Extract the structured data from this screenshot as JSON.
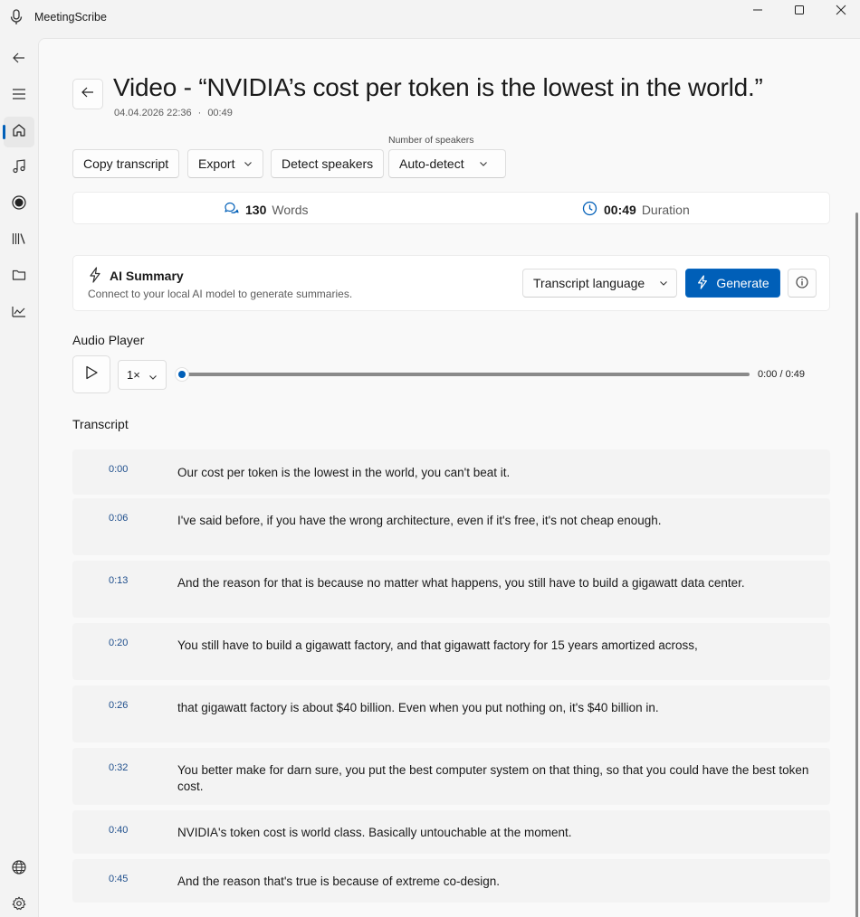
{
  "window": {
    "app_title": "MeetingScribe"
  },
  "header": {
    "title": "Video - “NVIDIA’s cost per token is the lowest in the world.”",
    "date": "04.04.2026 22:36",
    "separator": "·",
    "length": "00:49"
  },
  "toolbar": {
    "copy_label": "Copy transcript",
    "export_label": "Export",
    "detect_label": "Detect speakers",
    "speakers_label": "Number of speakers",
    "speakers_value": "Auto-detect"
  },
  "stats": {
    "words_value": "130",
    "words_label": "Words",
    "duration_value": "00:49",
    "duration_label": "Duration"
  },
  "ai_summary": {
    "title": "AI Summary",
    "subtitle": "Connect to your local AI model to generate summaries.",
    "language_value": "Transcript language",
    "generate_label": "Generate"
  },
  "player": {
    "section_title": "Audio Player",
    "speed_value": "1×",
    "progress": 0,
    "time_display": "0:00 / 0:49"
  },
  "transcript": {
    "section_title": "Transcript",
    "segments": [
      {
        "time": "0:00",
        "text": "Our cost per token is the lowest in the world, you can't beat it."
      },
      {
        "time": "0:06",
        "text": "I've said before, if you have the wrong architecture, even if it's free, it's not cheap enough."
      },
      {
        "time": "0:13",
        "text": "And the reason for that is because no matter what happens, you still have to build a gigawatt data center."
      },
      {
        "time": "0:20",
        "text": "You still have to build a gigawatt factory, and that gigawatt factory for 15 years amortized across,"
      },
      {
        "time": "0:26",
        "text": "that gigawatt factory is about $40 billion. Even when you put nothing on, it's $40 billion in."
      },
      {
        "time": "0:32",
        "text": "You better make for darn sure, you put the best computer system on that thing, so that you could have the best token cost."
      },
      {
        "time": "0:40",
        "text": "NVIDIA's token cost is world class. Basically untouchable at the moment."
      },
      {
        "time": "0:45",
        "text": "And the reason that's true is because of extreme co-design."
      }
    ]
  },
  "icons": {
    "accent_color": "#005fb8",
    "rail": [
      "back-icon",
      "menu-icon",
      "home-icon",
      "music-icon",
      "record-icon",
      "library-icon",
      "folder-icon",
      "chart-icon",
      "globe-icon",
      "settings-icon"
    ]
  }
}
